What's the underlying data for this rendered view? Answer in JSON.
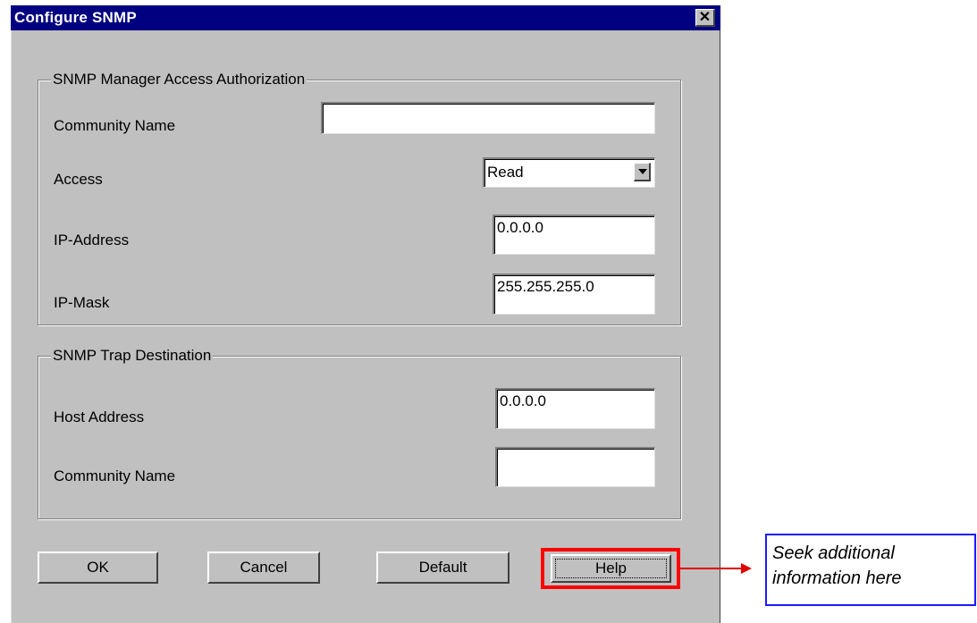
{
  "window": {
    "title": "Configure SNMP"
  },
  "manager_group": {
    "label": "SNMP Manager Access Authorization",
    "community_label": "Community Name",
    "community_value": "",
    "access_label": "Access",
    "access_value": "Read",
    "ip_label": "IP-Address",
    "ip_value": "0.0.0.0",
    "mask_label": "IP-Mask",
    "mask_value": "255.255.255.0"
  },
  "trap_group": {
    "label": "SNMP Trap Destination",
    "host_label": "Host Address",
    "host_value": "0.0.0.0",
    "community_label": "Community Name",
    "community_value": ""
  },
  "buttons": {
    "ok": "OK",
    "cancel": "Cancel",
    "default": "Default",
    "help": "Help"
  },
  "annotation": {
    "text": "Seek additional information here",
    "highlight_color": "#ff0000",
    "callout_border_color": "#1a1aff"
  }
}
